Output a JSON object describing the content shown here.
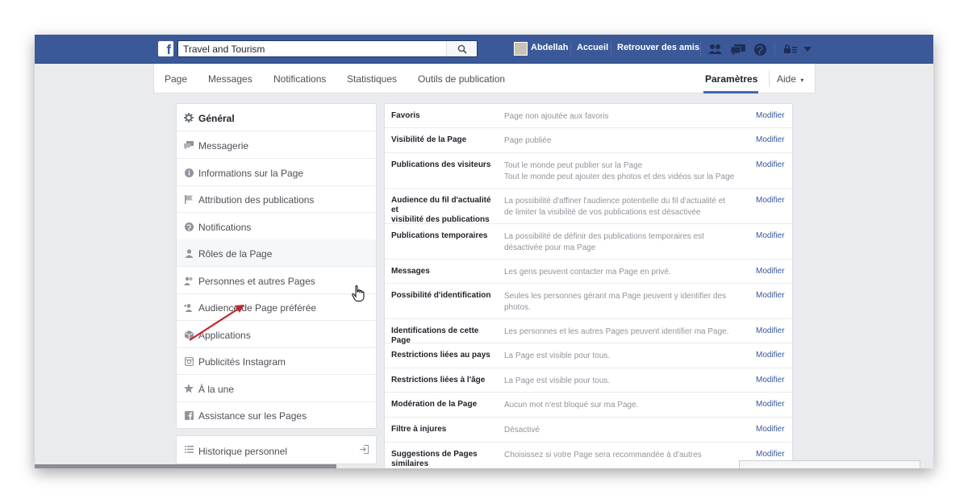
{
  "topbar": {
    "logo": "f",
    "search_value": "Travel and Tourism",
    "user_name": "Abdellah",
    "links": [
      "Accueil",
      "Retrouver des amis"
    ],
    "icons": [
      "friend-requests-icon",
      "messages-icon",
      "notifications-globe-icon",
      "privacy-lock-icon",
      "dropdown-caret-icon"
    ]
  },
  "subnav": {
    "tabs": [
      "Page",
      "Messages",
      "Notifications",
      "Statistiques",
      "Outils de publication"
    ],
    "active_tab": "Paramètres",
    "help": "Aide",
    "help_caret": "▾"
  },
  "sidebar": {
    "items": [
      {
        "label": "Général",
        "icon": "gear-icon"
      },
      {
        "label": "Messagerie",
        "icon": "speech-bubbles-icon"
      },
      {
        "label": "Informations sur la Page",
        "icon": "info-icon"
      },
      {
        "label": "Attribution des publications",
        "icon": "flag-icon"
      },
      {
        "label": "Notifications",
        "icon": "globe-icon"
      },
      {
        "label": "Rôles de la Page",
        "icon": "person-icon"
      },
      {
        "label": "Personnes et autres Pages",
        "icon": "people-icon"
      },
      {
        "label": "Audience de Page préférée",
        "icon": "person-add-icon"
      },
      {
        "label": "Applications",
        "icon": "cube-icon"
      },
      {
        "label": "Publicités Instagram",
        "icon": "instagram-icon"
      },
      {
        "label": "À la une",
        "icon": "star-icon"
      },
      {
        "label": "Assistance sur les Pages",
        "icon": "facebook-icon"
      }
    ],
    "history": {
      "label": "Historique personnel",
      "icon": "list-icon",
      "action_icon": "export-icon"
    }
  },
  "settings": {
    "edit_label": "Modifier",
    "rows": [
      {
        "name": [
          "Favoris"
        ],
        "value": [
          "Page non ajoutée aux favoris"
        ]
      },
      {
        "name": [
          "Visibilité de la Page"
        ],
        "value": [
          "Page publiée"
        ]
      },
      {
        "name": [
          "Publications des visiteurs"
        ],
        "value": [
          "Tout le monde peut publier sur la Page",
          "Tout le monde peut ajouter des photos et des vidéos sur la Page"
        ]
      },
      {
        "name": [
          "Audience du fil d'actualité et",
          "visibilité des publications"
        ],
        "value": [
          "La possibilité d'affiner l'audience potentielle du fil d'actualité et",
          "de limiter la visibilité de vos publications est désactivée"
        ]
      },
      {
        "name": [
          "Publications temporaires"
        ],
        "value": [
          "La possibilité de définir des publications temporaires est",
          "désactivée pour ma Page"
        ]
      },
      {
        "name": [
          "Messages"
        ],
        "value": [
          "Les gens peuvent contacter ma Page en privé."
        ]
      },
      {
        "name": [
          "Possibilité d'identification"
        ],
        "value": [
          "Seules les personnes gérant ma Page peuvent y identifier des",
          "photos."
        ]
      },
      {
        "name": [
          "Identifications de cette Page"
        ],
        "value": [
          "Les personnes et les autres Pages peuvent identifier ma Page."
        ]
      },
      {
        "name": [
          "Restrictions liées au pays"
        ],
        "value": [
          "La Page est visible pour tous."
        ]
      },
      {
        "name": [
          "Restrictions liées à l'âge"
        ],
        "value": [
          "La Page est visible pour tous."
        ]
      },
      {
        "name": [
          "Modération de la Page"
        ],
        "value": [
          "Aucun mot n'est bloqué sur ma Page."
        ]
      },
      {
        "name": [
          "Filtre à injures"
        ],
        "value": [
          "Désactivé"
        ]
      },
      {
        "name": [
          "Suggestions de Pages",
          "similaires"
        ],
        "value": [
          "Choisissez si votre Page sera recommandée à d'autres"
        ]
      }
    ]
  },
  "colors": {
    "brand": "#3b5998",
    "link": "#365899",
    "annotation_arrow": "#c0282d"
  }
}
